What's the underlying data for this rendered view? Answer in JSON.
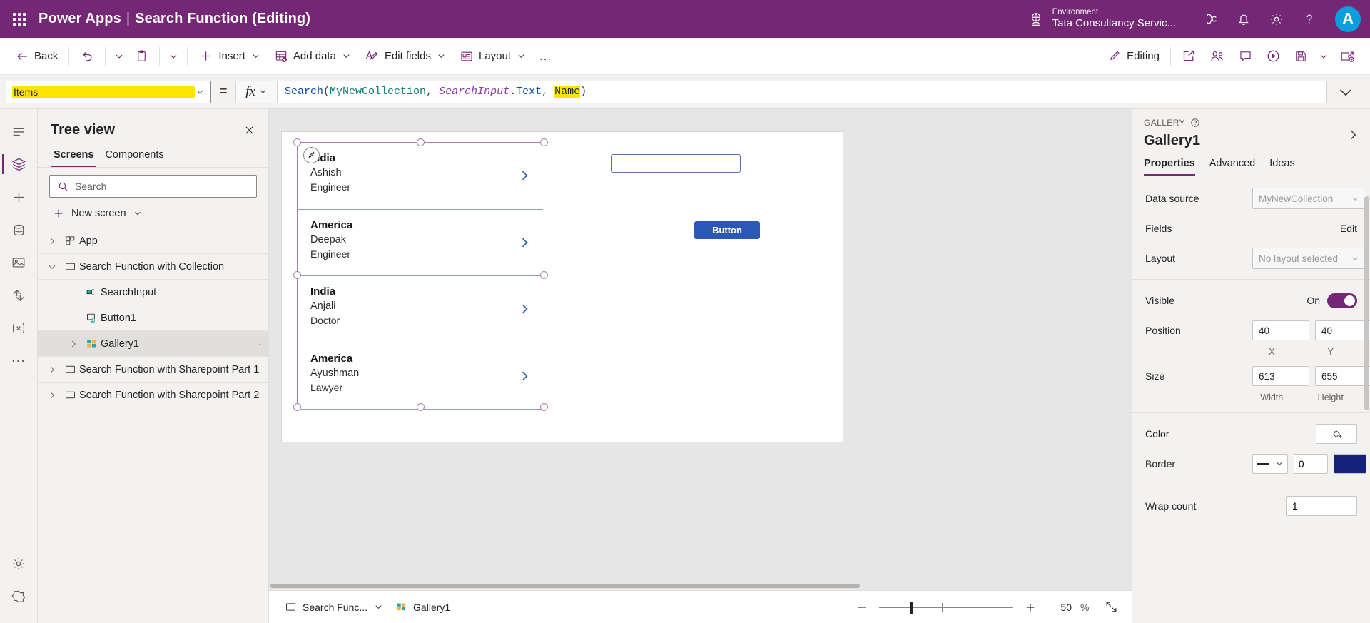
{
  "header": {
    "waffle": "app-launcher",
    "brand": "Power Apps",
    "separator": "|",
    "app_title": "Search Function (Editing)",
    "environment_label": "Environment",
    "environment_value": "Tata Consultancy Servic...",
    "icons": [
      "copilot-icon",
      "notifications-bell-icon",
      "settings-gear-icon",
      "help-question-icon"
    ],
    "avatar_initial": "A",
    "bg_color": "#742774",
    "avatar_color": "#0a9ede"
  },
  "toolbar": {
    "back": "Back",
    "undo": "undo",
    "undo_chevron": "chevron-down",
    "paste": "paste",
    "paste_chevron": "chevron-down",
    "insert": "Insert",
    "add_data": "Add data",
    "edit_fields": "Edit fields",
    "layout": "Layout",
    "more": "...",
    "editing": "Editing",
    "right_icons": [
      "share-icon",
      "co-authoring-icon",
      "comments-icon",
      "play-preview-icon",
      "save-icon",
      "save-chevron-icon",
      "publish-icon"
    ]
  },
  "formula_bar": {
    "property": "Items",
    "equals": "=",
    "fx": "fx",
    "fx_chevron": "chevron-down",
    "expand_chevron": "chevron-down",
    "tokens": [
      {
        "text": "Search",
        "kind": "fn"
      },
      {
        "text": "(",
        "kind": "punc"
      },
      {
        "text": "MyNewCollection",
        "kind": "src"
      },
      {
        "text": ", ",
        "kind": "punc"
      },
      {
        "text": "SearchInput",
        "kind": "ctrl"
      },
      {
        "text": ".",
        "kind": "punc"
      },
      {
        "text": "Text",
        "kind": "prop"
      },
      {
        "text": ", ",
        "kind": "punc"
      },
      {
        "text": "Name",
        "kind": "field"
      },
      {
        "text": ")",
        "kind": "punc"
      }
    ]
  },
  "rail": {
    "items": [
      {
        "name": "hamburger-menu-icon",
        "active": false
      },
      {
        "name": "tree-view-layers-icon",
        "active": true
      },
      {
        "name": "insert-plus-icon",
        "active": false
      },
      {
        "name": "data-cylinder-icon",
        "active": false
      },
      {
        "name": "media-icon",
        "active": false
      },
      {
        "name": "power-automate-icon",
        "active": false
      },
      {
        "name": "variables-x-icon",
        "active": false
      },
      {
        "name": "more-ellipsis-icon",
        "active": false
      }
    ],
    "bottom": [
      {
        "name": "settings-gear-icon"
      },
      {
        "name": "extensions-icon"
      }
    ]
  },
  "tree_view": {
    "title": "Tree view",
    "close": "close-icon",
    "tabs": [
      {
        "label": "Screens",
        "active": true
      },
      {
        "label": "Components",
        "active": false
      }
    ],
    "search_placeholder": "Search",
    "new_screen": "New screen",
    "items": [
      {
        "label": "App",
        "icon": "app-icon",
        "expander": "collapsed",
        "level": 1,
        "selected": false
      },
      {
        "label": "Search Function with Collection",
        "icon": "screen-icon",
        "expander": "expanded",
        "level": 1,
        "selected": false
      },
      {
        "label": "SearchInput",
        "icon": "text-input-icon",
        "expander": "none",
        "level": 2,
        "selected": false
      },
      {
        "label": "Button1",
        "icon": "button-icon",
        "expander": "none",
        "level": 2,
        "selected": false
      },
      {
        "label": "Gallery1",
        "icon": "gallery-icon",
        "expander": "collapsed",
        "level": 2,
        "selected": true,
        "overflow": "·"
      },
      {
        "label": "Search Function with Sharepoint Part 1",
        "icon": "screen-icon",
        "expander": "collapsed",
        "level": 1,
        "selected": false
      },
      {
        "label": "Search Function with Sharepoint Part 2",
        "icon": "screen-icon",
        "expander": "collapsed",
        "level": 1,
        "selected": false
      }
    ]
  },
  "canvas": {
    "gallery_rows": [
      {
        "country": "India",
        "person": "Ashish",
        "job": "Engineer"
      },
      {
        "country": "America",
        "person": "Deepak",
        "job": "Engineer"
      },
      {
        "country": "India",
        "person": "Anjali",
        "job": "Doctor"
      },
      {
        "country": "America",
        "person": "Ayushman",
        "job": "Lawyer"
      }
    ],
    "text_input_value": "",
    "button_label": "Button",
    "edit_badge": "edit-pencil-icon",
    "selection_color": "#b07cb0",
    "row_divider_color": "#8ba0c8",
    "button_color": "#2b57b5"
  },
  "status_bar": {
    "screen_name": "Search Func...",
    "screen_chevron": "chevron-down",
    "control_name": "Gallery1",
    "zoom_out": "minus-icon",
    "zoom_in": "plus-icon",
    "zoom_value": "50",
    "zoom_percent": "%",
    "fit_screen": "fit-to-screen-icon"
  },
  "properties": {
    "kicker": "GALLERY",
    "kicker_help": "help-circle-icon",
    "collapse": "chevron-right-icon",
    "name": "Gallery1",
    "tabs": [
      {
        "label": "Properties",
        "active": true
      },
      {
        "label": "Advanced",
        "active": false
      },
      {
        "label": "Ideas",
        "active": false
      }
    ],
    "data_source": {
      "label": "Data source",
      "value": "MyNewCollection"
    },
    "fields": {
      "label": "Fields",
      "action": "Edit"
    },
    "layout": {
      "label": "Layout",
      "value": "No layout selected"
    },
    "visible": {
      "label": "Visible",
      "state": "On"
    },
    "position": {
      "label": "Position",
      "x": "40",
      "y": "40",
      "x_label": "X",
      "y_label": "Y"
    },
    "size": {
      "label": "Size",
      "width": "613",
      "height": "655",
      "width_label": "Width",
      "height_label": "Height"
    },
    "color": {
      "label": "Color",
      "swatch": "fill-bucket-icon"
    },
    "border": {
      "label": "Border",
      "style": "solid-line",
      "thickness": "0",
      "color": "#14227a"
    },
    "wrap_count": {
      "label": "Wrap count",
      "value": "1"
    }
  }
}
